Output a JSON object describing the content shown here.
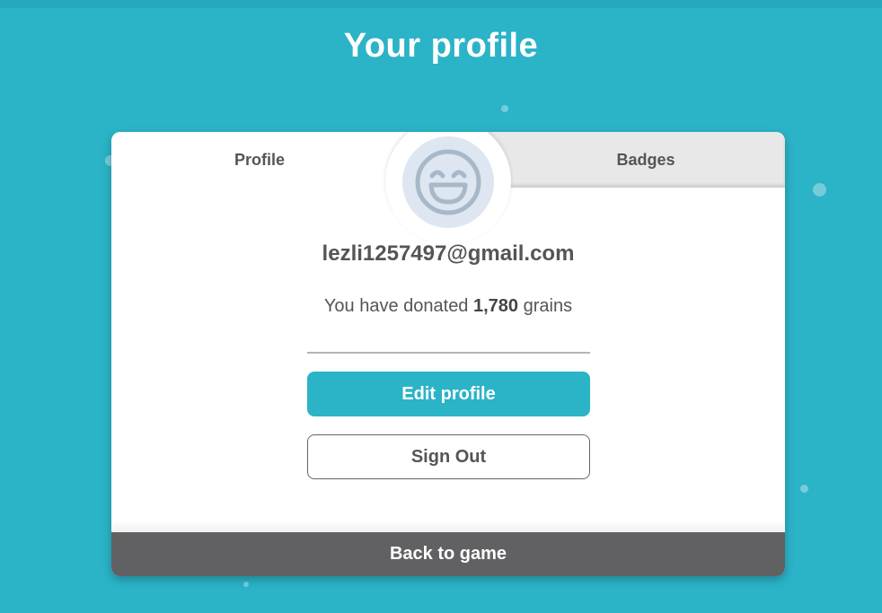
{
  "page": {
    "title": "Your profile",
    "background_color": "#2bb3c7",
    "accent_color": "#2bb3c7"
  },
  "tabs": [
    {
      "label": "Profile",
      "active": true
    },
    {
      "label": "Badges",
      "active": false
    }
  ],
  "avatar": {
    "icon": "smiley-face-icon"
  },
  "profile": {
    "email": "lezli1257497@gmail.com",
    "donated_prefix": "You have donated ",
    "donated_amount": "1,780",
    "donated_suffix": " grains"
  },
  "actions": {
    "edit_label": "Edit profile",
    "signout_label": "Sign Out",
    "back_label": "Back to game"
  }
}
